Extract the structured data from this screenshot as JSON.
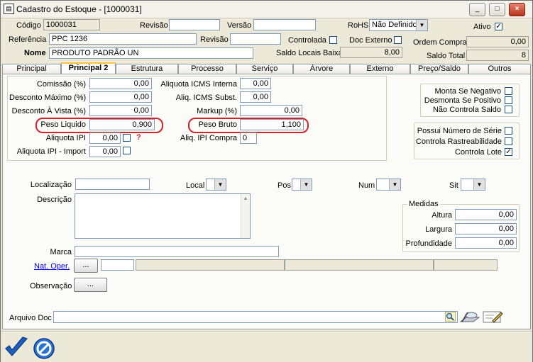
{
  "window": {
    "title": "Cadastro do Estoque - [1000031]",
    "min": "_",
    "max": "□",
    "close": "×"
  },
  "header": {
    "codigo_label": "Código",
    "codigo_value": "1000031",
    "revisao_label": "Revisão",
    "revisao_value": "",
    "versao_label": "Versão",
    "versao_value": "",
    "rohs_label": "RoHS",
    "rohs_value": "Não Definido",
    "ativo_label": "Ativo",
    "ativo_checked": "✓",
    "referencia_label": "Referência",
    "referencia_value": "PPC 1236",
    "revisao2_label": "Revisão",
    "revisao2_value": "",
    "controlada_label": "Controlada",
    "doc_externo_label": "Doc Externo",
    "ordem_compra_label": "Ordem Compra",
    "ordem_compra_value": "0,00",
    "nome_label": "Nome",
    "nome_value": "PRODUTO PADRÃO UN",
    "saldo_locais_label": "Saldo Locais Baixa",
    "saldo_locais_value": "8,00",
    "saldo_total_label": "Saldo Total",
    "saldo_total_value": "8"
  },
  "tabs": [
    {
      "label": "Principal"
    },
    {
      "label": "Principal 2"
    },
    {
      "label": "Estrutura"
    },
    {
      "label": "Processo"
    },
    {
      "label": "Serviço"
    },
    {
      "label": "Árvore"
    },
    {
      "label": "Externo"
    },
    {
      "label": "Preço/Saldo"
    },
    {
      "label": "Outros"
    }
  ],
  "fields": {
    "comissao_label": "Comissão (%)",
    "comissao_value": "0,00",
    "desconto_max_label": "Desconto Máximo (%)",
    "desconto_max_value": "0,00",
    "desconto_vista_label": "Desconto À Vista (%)",
    "desconto_vista_value": "0,00",
    "peso_liquido_label": "Peso Liquido",
    "peso_liquido_value": "0,900",
    "aliquota_ipi_label": "Aliquota IPI",
    "aliquota_ipi_value": "0,00",
    "aliquota_ipi_hint": "?",
    "aliquota_ipi_import_label": "Aliquota IPI - Import",
    "aliquota_ipi_import_value": "0,00",
    "icms_interna_label": "Aliquota ICMS Interna",
    "icms_interna_value": "0,00",
    "icms_subst_label": "Aliq. ICMS Subst.",
    "icms_subst_value": "0,00",
    "markup_label": "Markup (%)",
    "markup_value": "0,00",
    "peso_bruto_label": "Peso Bruto",
    "peso_bruto_value": "1,100",
    "ipi_compra_label": "Aliq. IPI Compra",
    "ipi_compra_value": "0"
  },
  "flags1": [
    {
      "label": "Monta Se Negativo",
      "checked": ""
    },
    {
      "label": "Desmonta Se Positivo",
      "checked": ""
    },
    {
      "label": "Não Controla Saldo",
      "checked": ""
    }
  ],
  "flags2": [
    {
      "label": "Possui Número de Série",
      "checked": ""
    },
    {
      "label": "Controla Rastreabilidade",
      "checked": ""
    },
    {
      "label": "Controla Lote",
      "checked": "✓"
    }
  ],
  "location": {
    "localizacao_label": "Localização",
    "localizacao_value": "",
    "local_label": "Local",
    "pos_label": "Pos",
    "num_label": "Num",
    "sit_label": "Sit",
    "descricao_label": "Descrição",
    "marca_label": "Marca",
    "marca_value": "",
    "nat_oper_label": "Nat. Oper.",
    "nat_oper_btn": "...",
    "observacao_label": "Observação",
    "observacao_btn": "...",
    "arquivo_doc_label": "Arquivo Doc",
    "arquivo_doc_value": ""
  },
  "medidas": {
    "title": "Medidas",
    "altura_label": "Altura",
    "altura_value": "0,00",
    "largura_label": "Largura",
    "largura_value": "0,00",
    "profundidade_label": "Profundidade",
    "profundidade_value": "0,00"
  },
  "icons": {
    "confirm": "check-icon",
    "cancel": "cancel-icon",
    "search": "search-icon",
    "scan": "scan-icon",
    "edit": "edit-icon"
  },
  "colors": {
    "highlight_oval": "#d4212a",
    "tab_active_top": "#ffc83c",
    "confirm_blue": "#1f5fbf"
  }
}
